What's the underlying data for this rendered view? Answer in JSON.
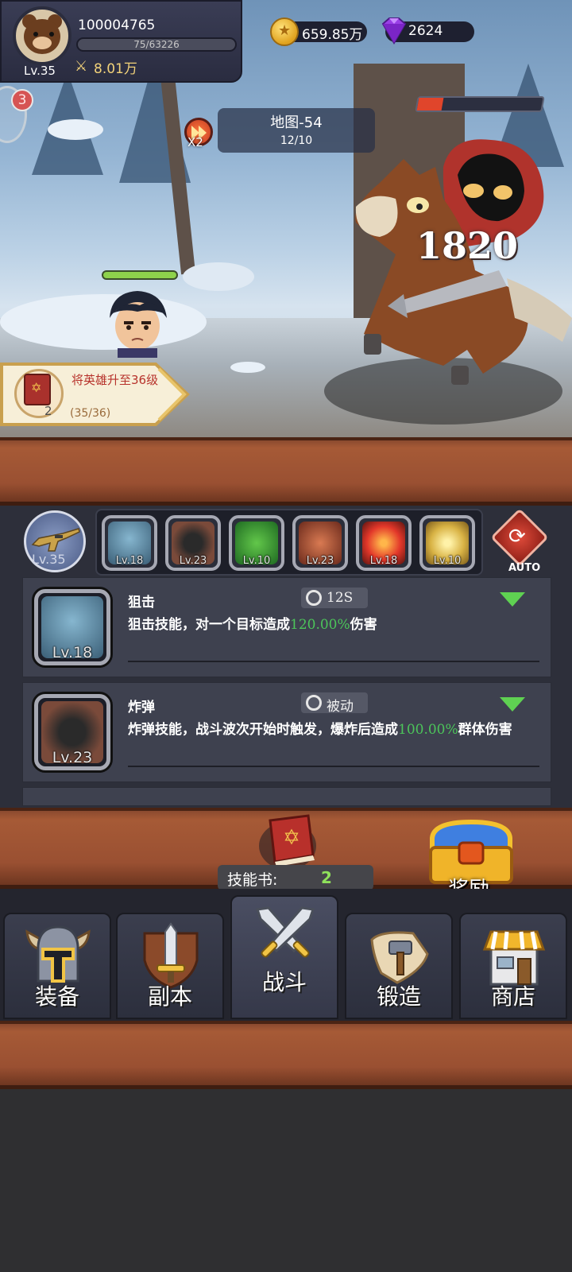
{
  "player": {
    "id": "100004765",
    "level": "Lv.35",
    "exp": "75/63226",
    "exp_fraction": 0.0012,
    "power": "8.01万"
  },
  "currency": {
    "gold": "659.85万",
    "gems": "2624"
  },
  "side_badge": "3",
  "map": {
    "title": "地图-54",
    "progress": "12/10",
    "speed": "X2"
  },
  "battle": {
    "damage": "1820",
    "enemy_hp_fraction": 0.2,
    "hero_hp_fraction": 1.0
  },
  "quest": {
    "title": "将英雄升至36级",
    "progress": "(35/36)",
    "reward_count": "2"
  },
  "main_weapon": {
    "level": "Lv.35"
  },
  "skill_slots": [
    {
      "level": "Lv.18",
      "icon": "sniper-skill-icon"
    },
    {
      "level": "Lv.23",
      "icon": "bomb-skill-icon"
    },
    {
      "level": "Lv.10",
      "icon": "poison-skill-icon"
    },
    {
      "level": "Lv.23",
      "icon": "beast-skill-icon"
    },
    {
      "level": "Lv.18",
      "icon": "fireball-skill-icon"
    },
    {
      "level": "Lv.10",
      "icon": "lightning-skill-icon"
    }
  ],
  "auto_label": "AUTO",
  "skills": [
    {
      "name": "狙击",
      "level": "Lv.18",
      "cooldown": "12S",
      "desc_prefix": "狙击技能，对一个目标造成",
      "desc_value": "120.00%",
      "desc_suffix": "伤害"
    },
    {
      "name": "炸弹",
      "level": "Lv.23",
      "cooldown": "被动",
      "desc_prefix": "炸弹技能，战斗波次开始时触发，爆炸后造成",
      "desc_value": "100.00%",
      "desc_suffix": "群体伤害"
    }
  ],
  "skill_book": {
    "label": "技能书:",
    "count": "2"
  },
  "reward_label": "奖励",
  "nav": [
    {
      "label": "装备",
      "icon": "helmet-icon"
    },
    {
      "label": "副本",
      "icon": "sword-shield-icon"
    },
    {
      "label": "战斗",
      "icon": "crossed-swords-icon",
      "active": true
    },
    {
      "label": "锻造",
      "icon": "hammer-scroll-icon"
    },
    {
      "label": "商店",
      "icon": "shop-icon"
    }
  ],
  "colors": {
    "highlight_green": "#4cc55a",
    "gold": "#f2d27a",
    "wood": "#9a5032"
  }
}
